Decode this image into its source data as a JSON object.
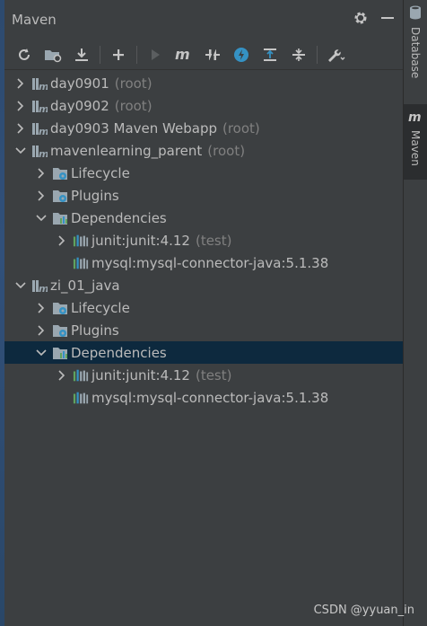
{
  "panel": {
    "title": "Maven"
  },
  "toolbar": {
    "buttons": [
      "reload-all",
      "add-maven-project",
      "download-sources",
      "add",
      "run",
      "execute-goal",
      "toggle-offline",
      "skip-tests",
      "show-dependencies",
      "collapse-all",
      "settings"
    ]
  },
  "tree": {
    "day0901": {
      "name": "day0901",
      "tag": "(root)"
    },
    "day0902": {
      "name": "day0902",
      "tag": "(root)"
    },
    "day0903": {
      "name": "day0903 Maven Webapp",
      "tag": "(root)"
    },
    "parent": {
      "name": "mavenlearning_parent",
      "tag": "(root)",
      "lifecycle": "Lifecycle",
      "plugins": "Plugins",
      "dependencies": "Dependencies",
      "dep1": {
        "name": "junit:junit:4.12",
        "tag": "(test)"
      },
      "dep2": {
        "name": "mysql:mysql-connector-java:5.1.38"
      }
    },
    "zi": {
      "name": "zi_01_java",
      "lifecycle": "Lifecycle",
      "plugins": "Plugins",
      "dependencies": "Dependencies",
      "dep1": {
        "name": "junit:junit:4.12",
        "tag": "(test)"
      },
      "dep2": {
        "name": "mysql:mysql-connector-java:5.1.38"
      }
    }
  },
  "sidebar": {
    "database": "Database",
    "maven": "Maven"
  },
  "watermark": "CSDN @yyuan_in",
  "colors": {
    "bg": "#3c3f41",
    "selected": "#0d293e",
    "accent": "#3592c4"
  }
}
